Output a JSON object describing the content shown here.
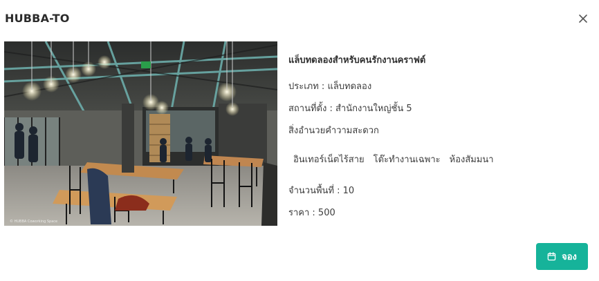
{
  "modal": {
    "title": "HUBBA-TO",
    "close_icon": "close-icon"
  },
  "space": {
    "photo_icon": "coworking-space-photo",
    "photo_caption": "© HUBBA Coworking Space",
    "name": "แล็บทดลองสำหรับคนรักงานคราฟต์",
    "type_label": "ประเภท : แล็บทดลอง",
    "location_label": "สถานที่ตั้ง : สำนักงานใหญ่ชั้น 5",
    "amenities_heading": "สิ่งอำนวยคำวามสะดวก",
    "amenities": [
      "อินเทอร์เน็ตไร้สาย",
      "โต๊ะทำงานเฉพาะ",
      "ห้องสัมมนา"
    ],
    "capacity_label": "จำนวนพื้นที่ : 10",
    "price_label": "ราคา : 500"
  },
  "actions": {
    "book_label": "จอง",
    "book_icon": "calendar-icon"
  },
  "colors": {
    "accent": "#16b39a",
    "title": "#2b2b2b",
    "text": "#3c3c3c"
  }
}
